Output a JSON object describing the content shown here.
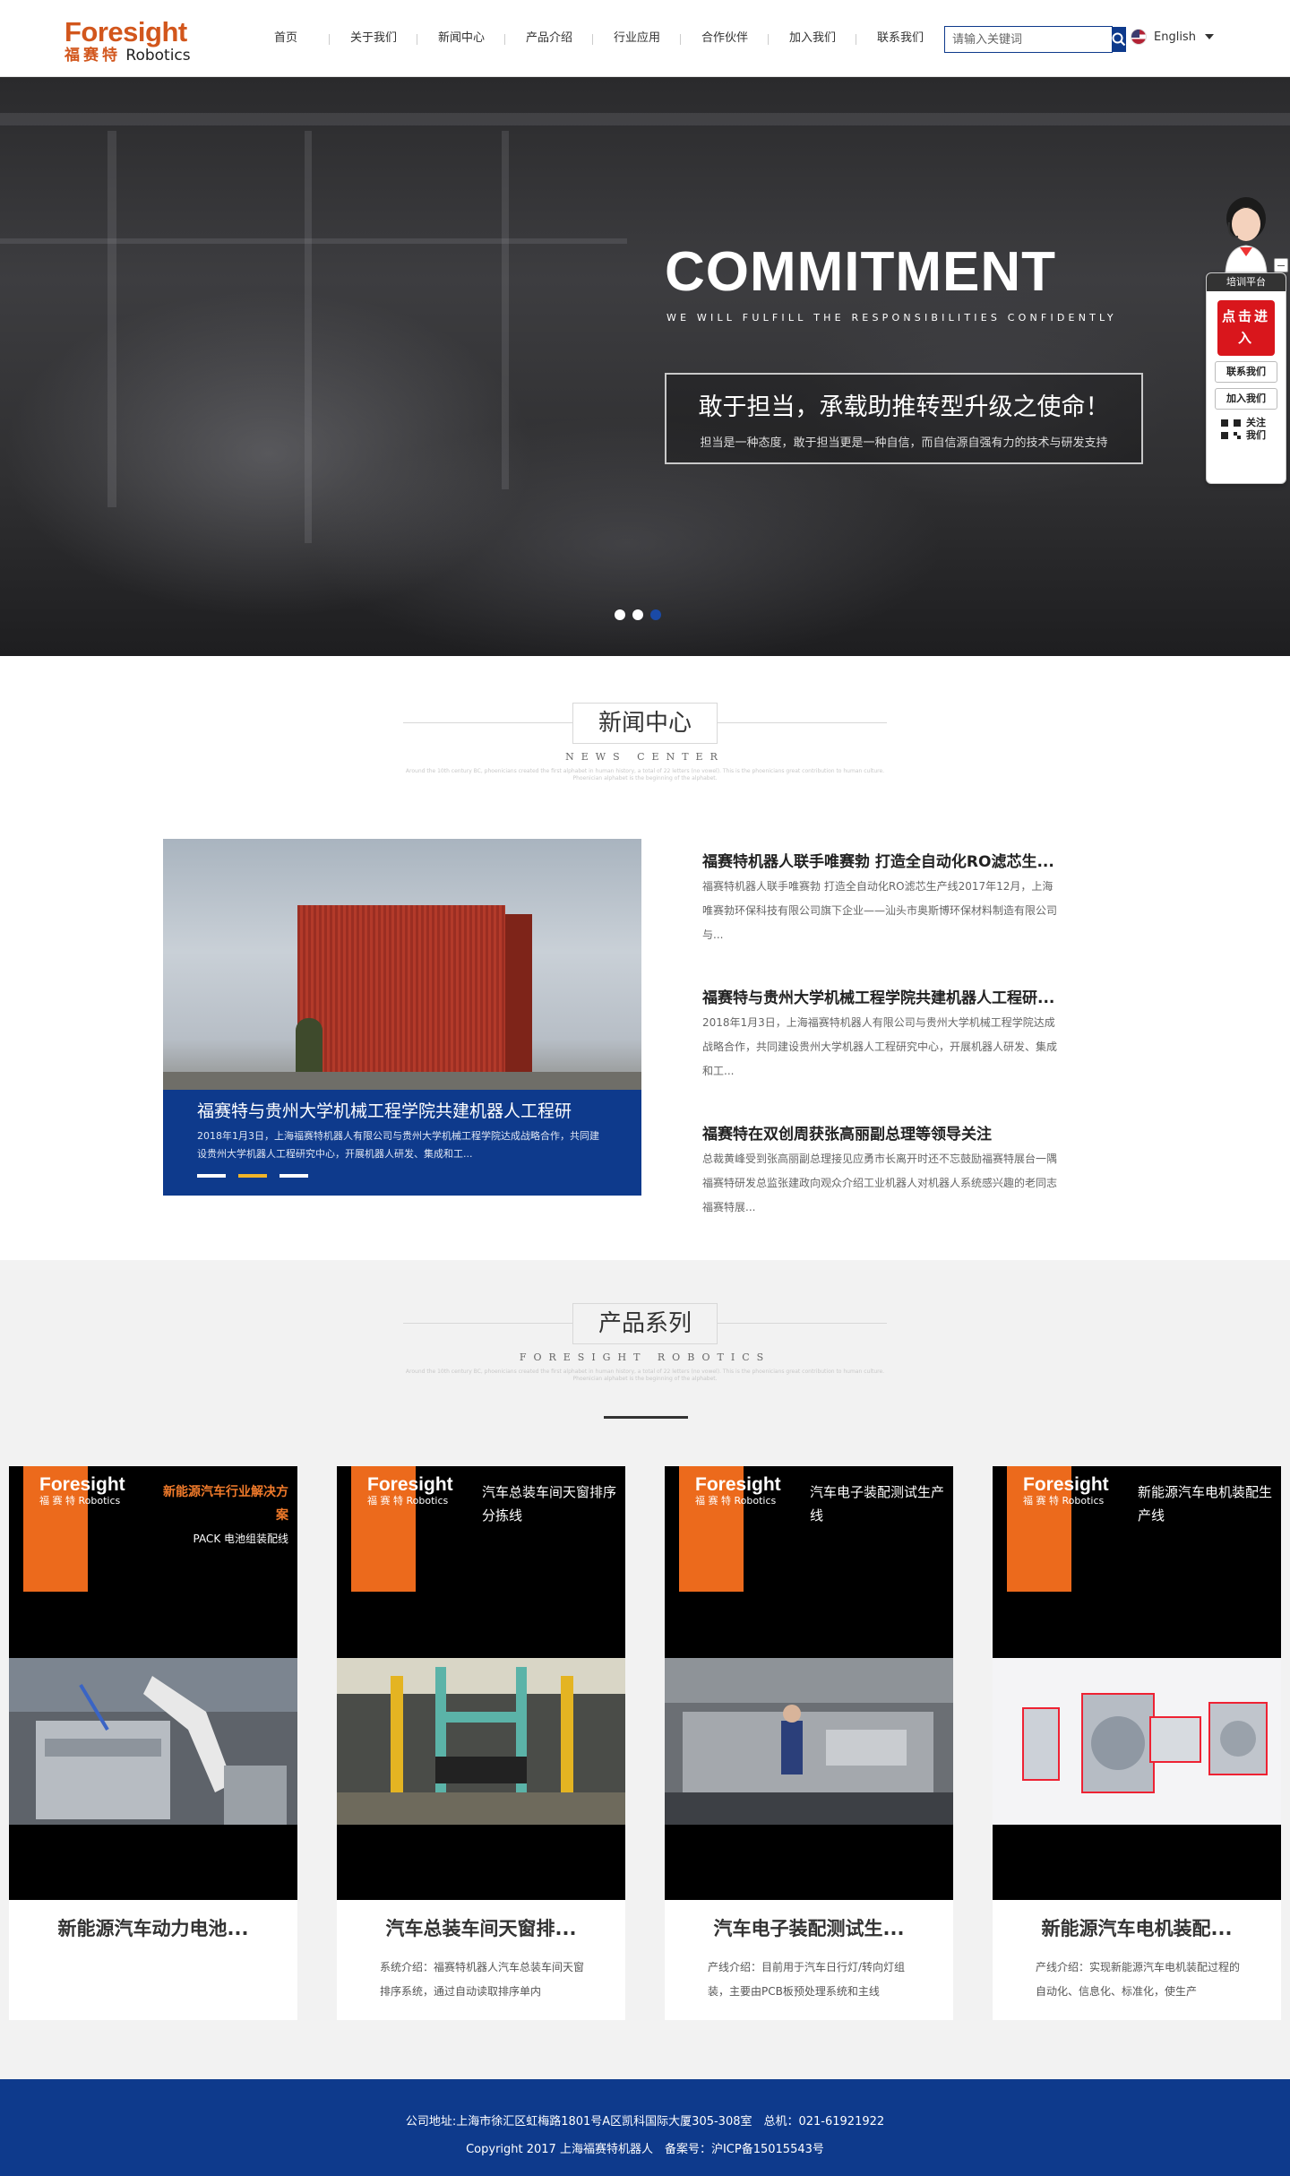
{
  "header": {
    "logo_main": "Foresight",
    "logo_cn": "福赛特",
    "logo_sub": "Robotics",
    "nav": [
      "首页",
      "关于我们",
      "新闻中心",
      "产品介绍",
      "行业应用",
      "合作伙伴",
      "加入我们",
      "联系我们"
    ],
    "search_placeholder": "请输入关键词",
    "search_icon": "search-icon",
    "language": "English"
  },
  "banner": {
    "title": "COMMITMENT",
    "subtitle": "WE WILL FULFILL THE RESPONSIBILITIES CONFIDENTLY",
    "slogan": "敢于担当，承载助推转型升级之使命！",
    "slogan_sub": "担当是一种态度，敢于担当更是一种自信，而自信源自强有力的技术与研发支持",
    "slides": 3,
    "active_slide": 3
  },
  "side_widget": {
    "head": "培训平台",
    "cta": "点击进入",
    "contact": "联系我们",
    "join": "加入我们",
    "follow": "关注我们"
  },
  "news": {
    "title": "新闻中心",
    "en": "NEWS CENTER",
    "fine_print": "Around the 10th century BC, phoenicians created the first alphabet in human history, a total of 22 letters (no vowel). This is the phoenicians great contribution to human culture. Phoenician alphabet is the beginning of the alphabet.",
    "feature_title": "福赛特与贵州大学机械工程学院共建机器人工程研",
    "feature_desc": "2018年1月3日，上海福赛特机器人有限公司与贵州大学机械工程学院达成战略合作，共同建设贵州大学机器人工程研究中心，开展机器人研发、集成和工...",
    "items": [
      {
        "title": "福赛特机器人联手唯赛勃 打造全自动化RO滤芯生...",
        "desc": "福赛特机器人联手唯赛勃 打造全自动化RO滤芯生产线2017年12月，上海唯赛勃环保科技有限公司旗下企业——汕头市奥斯博环保材料制造有限公司与..."
      },
      {
        "title": "福赛特与贵州大学机械工程学院共建机器人工程研...",
        "desc": "2018年1月3日，上海福赛特机器人有限公司与贵州大学机械工程学院达成战略合作，共同建设贵州大学机器人工程研究中心，开展机器人研发、集成和工..."
      },
      {
        "title": "福赛特在双创周获张高丽副总理等领导关注",
        "desc": "总裁黄峰受到张高丽副总理接见应勇市长离开时还不忘鼓励福赛特展台一隅福赛特研发总监张建政向观众介绍工业机器人对机器人系统感兴趣的老同志福赛特展..."
      }
    ]
  },
  "products": {
    "title": "产品系列",
    "en": "FORESIGHT ROBOTICS",
    "fine_print": "Around the 10th century BC, phoenicians created the first alphabet in human history, a total of 22 letters (no vowel). This is the phoenicians great contribution to human culture. Phoenician alphabet is the beginning of the alphabet.",
    "cards": [
      {
        "logo": "Foresight",
        "logo_sub": "福 赛 特 Robotics",
        "tag_main": "新能源汽车行业解决方案",
        "tag_sub": "PACK 电池组装配线",
        "name": "新能源汽车动力电池...",
        "desc": ""
      },
      {
        "logo": "Foresight",
        "logo_sub": "福 赛 特 Robotics",
        "tag": "汽车总装车间天窗排序分拣线",
        "name": "汽车总装车间天窗排...",
        "desc": "系统介绍：福赛特机器人汽车总装车间天窗排序系统，通过自动读取排序单内"
      },
      {
        "logo": "Foresight",
        "logo_sub": "福 赛 特 Robotics",
        "tag": "汽车电子装配测试生产线",
        "name": "汽车电子装配测试生...",
        "desc": "产线介绍：目前用于汽车日行灯/转向灯组装，主要由PCB板预处理系统和主线"
      },
      {
        "logo": "Foresight",
        "logo_sub": "福 赛 特 Robotics",
        "tag": "新能源汽车电机装配生产线",
        "name": "新能源汽车电机装配...",
        "desc": "产线介绍：实现新能源汽车电机装配过程的自动化、信息化、标准化，使生产"
      }
    ]
  },
  "footer": {
    "address": "公司地址:上海市徐汇区虹梅路1801号A区凯科国际大厦305-308室　总机：021-61921922",
    "copyright": "Copyright 2017 上海福赛特机器人　备案号：沪ICP备15015543号"
  },
  "colors": {
    "brand_orange": "#d2561c",
    "brand_blue": "#0e3a8c",
    "cta_red": "#d9161c"
  }
}
